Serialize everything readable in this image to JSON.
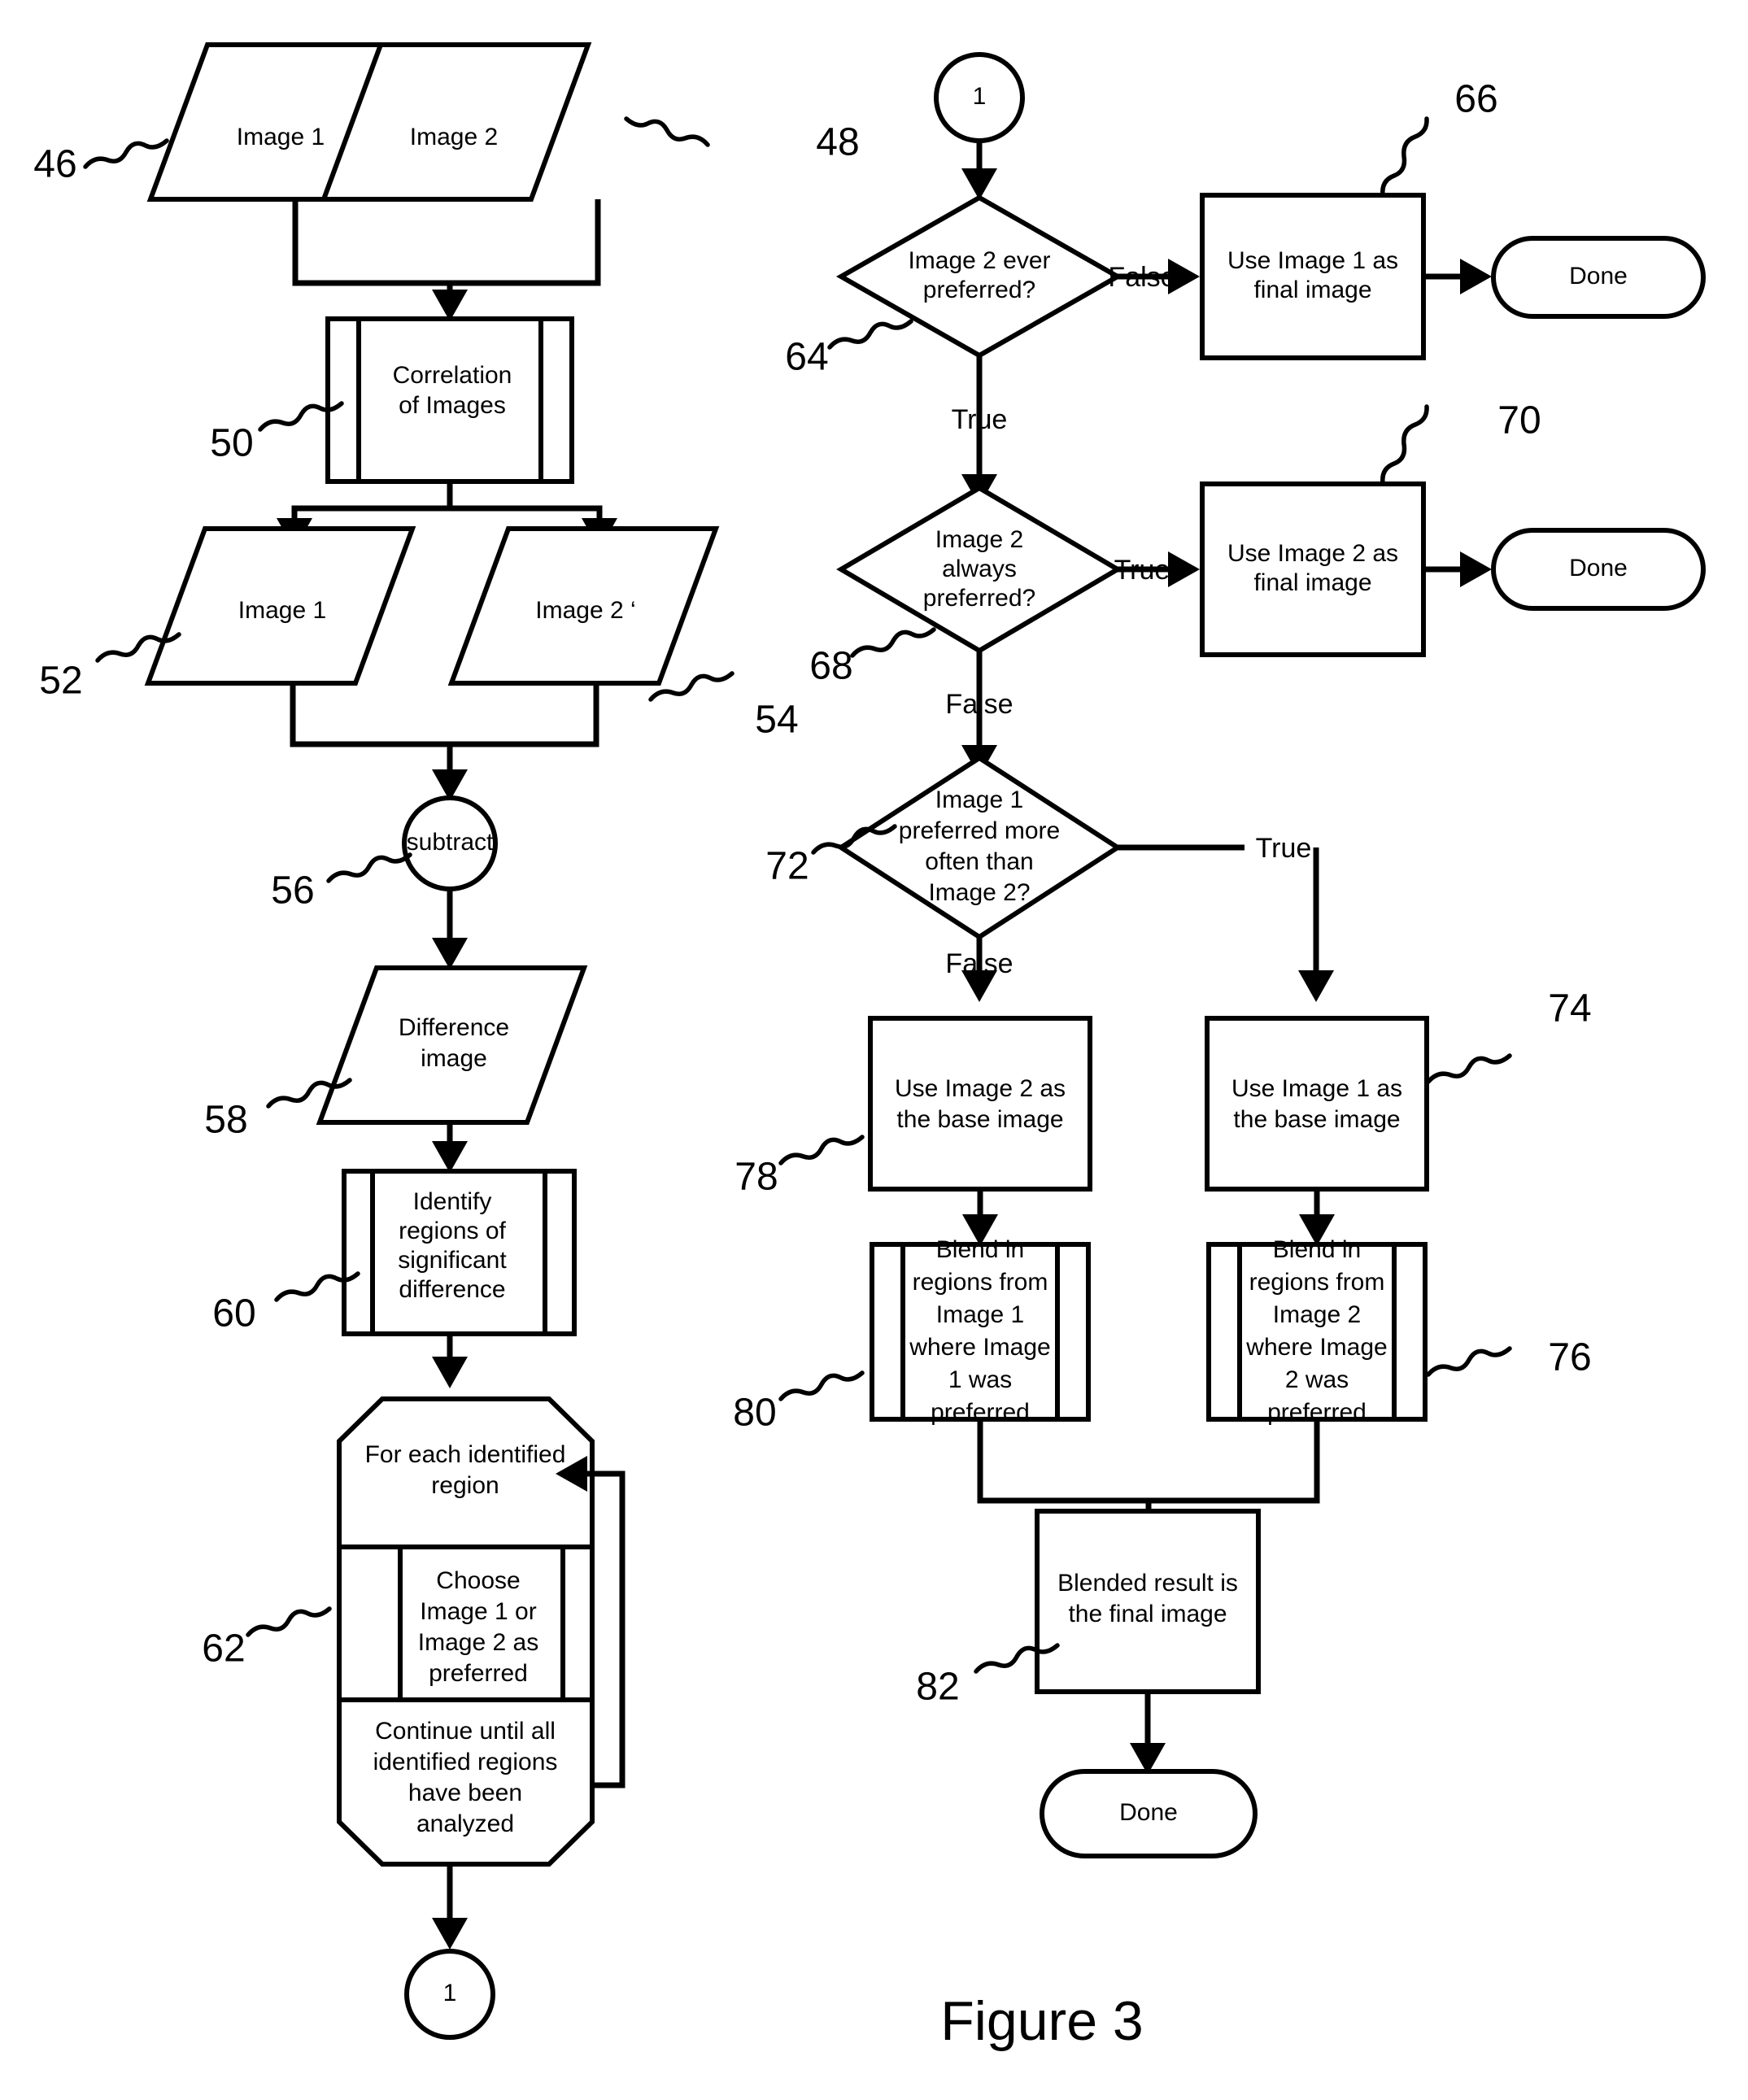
{
  "figure": {
    "caption": "Figure 3"
  },
  "nodes": {
    "image1_src": {
      "ref": "46",
      "text": "Image 1",
      "kind": "data-parallelogram"
    },
    "image2_src": {
      "ref": "48",
      "text": "Image 2",
      "kind": "data-parallelogram"
    },
    "correlation": {
      "ref": "50",
      "lines": [
        "Correlation",
        "of Images"
      ],
      "kind": "predefined-process"
    },
    "image1_corr": {
      "ref": "52",
      "text": "Image 1",
      "kind": "data-parallelogram"
    },
    "image2_corr": {
      "ref": "54",
      "text": "Image 2 ‘",
      "kind": "data-parallelogram"
    },
    "subtract": {
      "ref": "56",
      "text": "subtract",
      "kind": "circle"
    },
    "difference": {
      "ref": "58",
      "lines": [
        "Difference",
        "image"
      ],
      "kind": "data-parallelogram"
    },
    "identify": {
      "ref": "60",
      "lines": [
        "Identify",
        "regions of",
        "significant",
        "difference"
      ],
      "kind": "predefined-process"
    },
    "loop": {
      "ref": "62",
      "header_lines": [
        "For each identified",
        "region"
      ],
      "body_lines": [
        "Choose",
        "Image 1 or",
        "Image 2 as",
        "preferred"
      ],
      "footer_lines": [
        "Continue until all",
        "identified regions",
        "have been",
        "analyzed"
      ],
      "kind": "loop-limit"
    },
    "connector_out": {
      "text": "1",
      "kind": "connector-circle"
    },
    "connector_in": {
      "text": "1",
      "kind": "connector-circle"
    },
    "d_ever": {
      "ref": "64",
      "lines": [
        "Image 2 ever",
        "preferred?"
      ],
      "kind": "decision"
    },
    "use1_final": {
      "ref": "66",
      "lines": [
        "Use Image 1 as",
        "final image"
      ],
      "kind": "process"
    },
    "done_1": {
      "text": "Done",
      "kind": "terminator"
    },
    "d_always": {
      "ref": "68",
      "lines": [
        "Image 2",
        "always",
        "preferred?"
      ],
      "kind": "decision"
    },
    "use2_final": {
      "ref": "70",
      "lines": [
        "Use Image 2 as",
        "final image"
      ],
      "kind": "process"
    },
    "done_2": {
      "text": "Done",
      "kind": "terminator"
    },
    "d_more_often": {
      "ref": "72",
      "lines": [
        "Image 1",
        "preferred more",
        "often than",
        "Image 2?"
      ],
      "kind": "decision"
    },
    "use1_base": {
      "ref": "74",
      "lines": [
        "Use Image 1 as",
        "the  base image"
      ],
      "kind": "process"
    },
    "blend_img2": {
      "ref": "76",
      "lines": [
        "Blend in",
        "regions from",
        "Image 2",
        "where Image",
        "2 was",
        "preferred"
      ],
      "kind": "predefined-process"
    },
    "use2_base": {
      "ref": "78",
      "lines": [
        "Use Image 2 as",
        "the base image"
      ],
      "kind": "process"
    },
    "blend_img1": {
      "ref": "80",
      "lines": [
        "Blend in",
        "regions from",
        "Image 1",
        "where Image",
        "1 was",
        "preferred"
      ],
      "kind": "predefined-process"
    },
    "blended_final": {
      "ref": "82",
      "lines": [
        "Blended result is",
        "the final image"
      ],
      "kind": "process"
    },
    "done_3": {
      "text": "Done",
      "kind": "terminator"
    }
  },
  "edge_labels": {
    "ever_false": "False",
    "ever_true": "True",
    "always_true": "True",
    "always_false": "False",
    "more_true": "True",
    "more_false": "False"
  },
  "colors": {
    "stroke": "#000000",
    "fill": "#ffffff"
  }
}
